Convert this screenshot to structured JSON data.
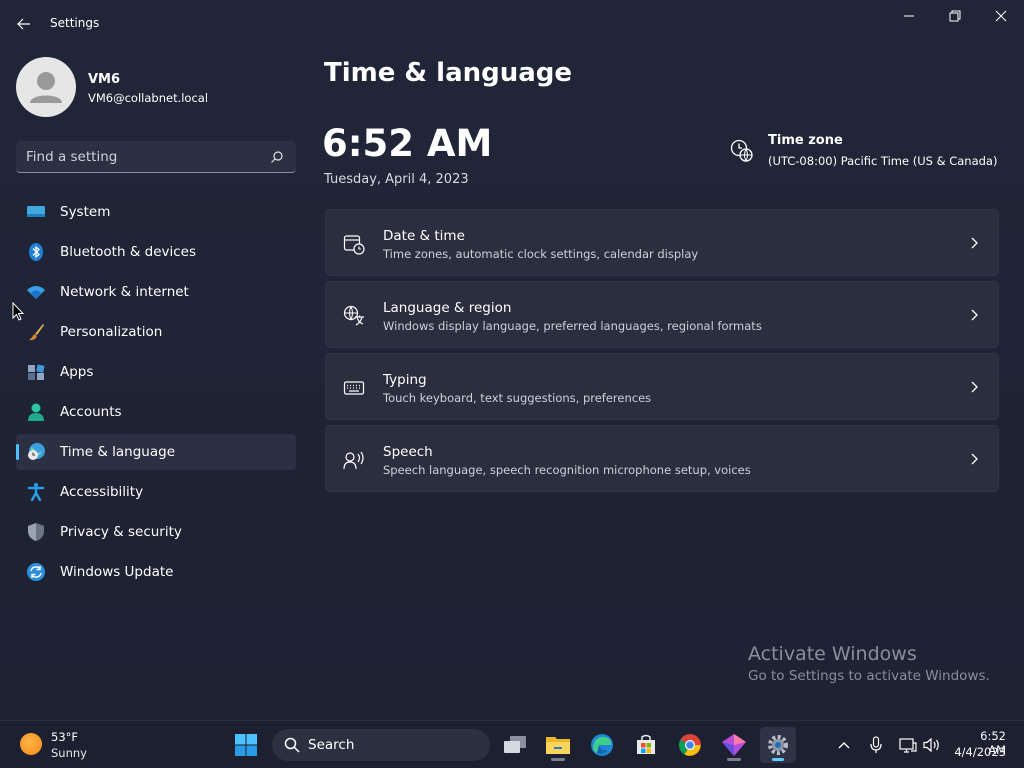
{
  "window": {
    "app_title": "Settings",
    "controls": {
      "minimize": "minimize",
      "maximize": "restore",
      "close": "close"
    }
  },
  "profile": {
    "name": "VM6",
    "email": "VM6@collabnet.local"
  },
  "search": {
    "placeholder": "Find a setting"
  },
  "sidebar": {
    "items": [
      {
        "label": "System",
        "icon": "monitor-icon",
        "active": false
      },
      {
        "label": "Bluetooth & devices",
        "icon": "bluetooth-icon",
        "active": false
      },
      {
        "label": "Network & internet",
        "icon": "wifi-icon",
        "active": false
      },
      {
        "label": "Personalization",
        "icon": "brush-icon",
        "active": false
      },
      {
        "label": "Apps",
        "icon": "apps-icon",
        "active": false
      },
      {
        "label": "Accounts",
        "icon": "person-icon",
        "active": false
      },
      {
        "label": "Time & language",
        "icon": "globe-clock-icon",
        "active": true
      },
      {
        "label": "Accessibility",
        "icon": "accessibility-icon",
        "active": false
      },
      {
        "label": "Privacy & security",
        "icon": "shield-icon",
        "active": false
      },
      {
        "label": "Windows Update",
        "icon": "update-icon",
        "active": false
      }
    ]
  },
  "main": {
    "title": "Time & language",
    "clock": {
      "time": "6:52 AM",
      "date": "Tuesday, April 4, 2023"
    },
    "timezone": {
      "title": "Time zone",
      "value": "(UTC-08:00) Pacific Time (US & Canada)"
    },
    "cards": [
      {
        "title": "Date & time",
        "subtitle": "Time zones, automatic clock settings, calendar display",
        "icon": "calendar-clock-icon"
      },
      {
        "title": "Language & region",
        "subtitle": "Windows display language, preferred languages, regional formats",
        "icon": "language-icon"
      },
      {
        "title": "Typing",
        "subtitle": "Touch keyboard, text suggestions, preferences",
        "icon": "keyboard-icon"
      },
      {
        "title": "Speech",
        "subtitle": "Speech language, speech recognition microphone setup, voices",
        "icon": "speech-icon"
      }
    ]
  },
  "watermark": {
    "title": "Activate Windows",
    "subtitle": "Go to Settings to activate Windows."
  },
  "taskbar": {
    "weather": {
      "temp": "53°F",
      "condition": "Sunny"
    },
    "search_label": "Search",
    "apps": [
      "start-icon",
      "task-view-icon",
      "file-explorer-icon",
      "edge-icon",
      "store-icon",
      "chrome-icon",
      "copilot-icon",
      "settings-icon"
    ],
    "tray": {
      "time": "6:52 AM",
      "date": "4/4/2023"
    }
  },
  "colors": {
    "accent": "#4cc2ff",
    "background": "#202638",
    "card": "#2a2e3f",
    "taskbar": "#1c2030"
  }
}
